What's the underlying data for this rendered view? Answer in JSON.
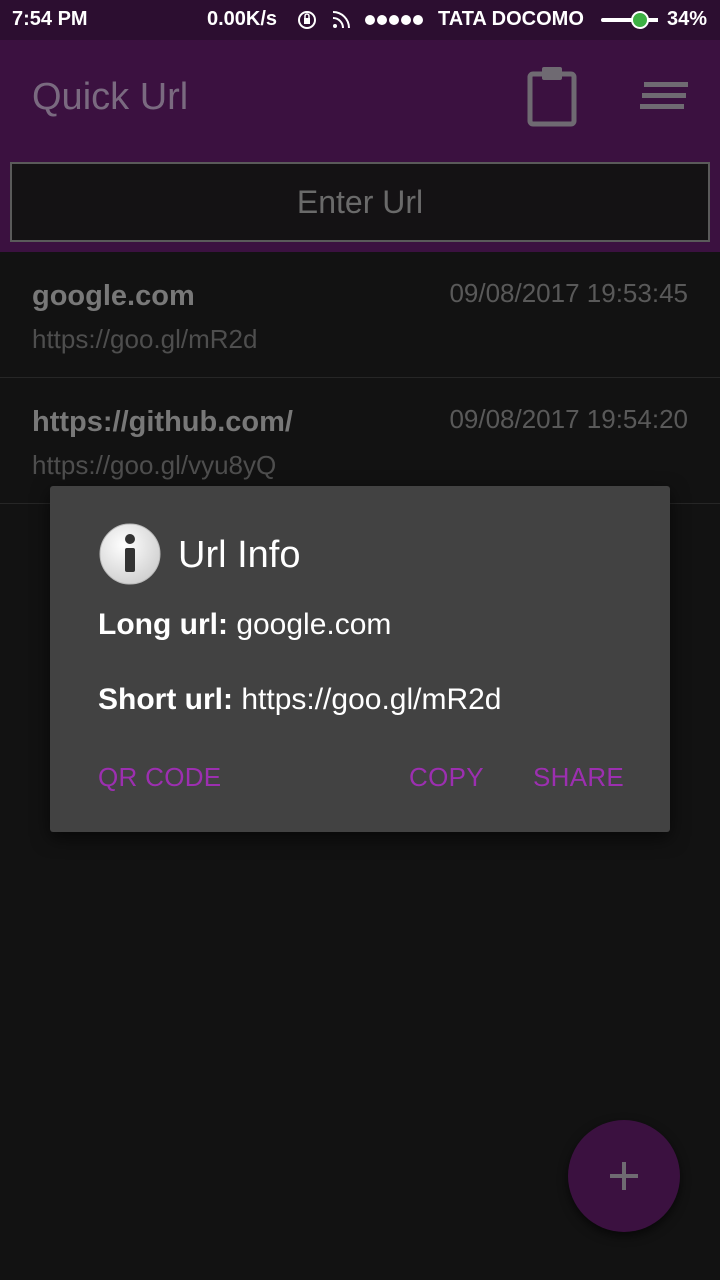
{
  "status_bar": {
    "time": "7:54 PM",
    "speed": "0.00K/s",
    "carrier": "TATA DOCOMO",
    "battery": "34%"
  },
  "app_bar": {
    "title": "Quick Url",
    "icons": [
      "clipboard-icon",
      "menu-icon"
    ],
    "input_placeholder": "Enter Url",
    "color": "#3b1140"
  },
  "list": {
    "items": [
      {
        "long_url": "google.com",
        "short_url": "https://goo.gl/mR2d",
        "date": "09/08/2017 19:53:45"
      },
      {
        "long_url": "https://github.com/",
        "short_url": "https://goo.gl/vyu8yQ",
        "date": "09/08/2017 19:54:20"
      }
    ]
  },
  "dialog": {
    "title": "Url Info",
    "long_label": "Long url:",
    "long_value": "google.com",
    "short_label": "Short url:",
    "short_value": "https://goo.gl/mR2d",
    "qr_button": "QR CODE",
    "copy_button": "COPY",
    "share_button": "SHARE",
    "accent": "#9c2fb0"
  },
  "fab": {
    "icon": "plus-icon"
  }
}
